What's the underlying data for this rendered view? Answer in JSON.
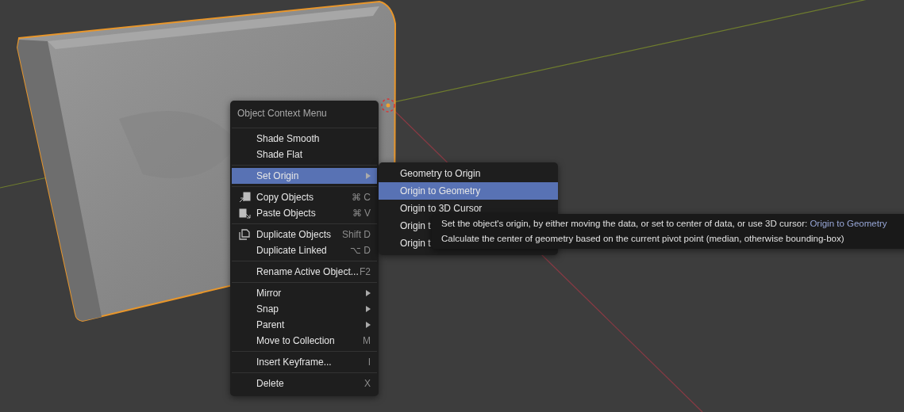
{
  "menu": {
    "title": "Object Context Menu",
    "sections": [
      [
        {
          "label": "Shade Smooth",
          "selected": false
        },
        {
          "label": "Shade Flat",
          "selected": false
        }
      ],
      [
        {
          "label": "Set Origin",
          "submenu": true,
          "selected": true
        }
      ],
      [
        {
          "label": "Copy Objects",
          "shortcut": "⌘ C",
          "kind": "copy",
          "selected": false
        },
        {
          "label": "Paste Objects",
          "shortcut": "⌘ V",
          "kind": "paste",
          "selected": false
        }
      ],
      [
        {
          "label": "Duplicate Objects",
          "shortcut": "Shift D",
          "kind": "duplicate",
          "selected": false
        },
        {
          "label": "Duplicate Linked",
          "shortcut": "⌥ D",
          "selected": false
        }
      ],
      [
        {
          "label": "Rename Active Object...",
          "shortcut": "F2",
          "selected": false
        }
      ],
      [
        {
          "label": "Mirror",
          "submenu": true,
          "selected": false
        },
        {
          "label": "Snap",
          "submenu": true,
          "selected": false
        },
        {
          "label": "Parent",
          "submenu": true,
          "selected": false
        },
        {
          "label": "Move to Collection",
          "shortcut": "M",
          "selected": false
        }
      ],
      [
        {
          "label": "Insert Keyframe...",
          "shortcut": "I",
          "selected": false
        }
      ],
      [
        {
          "label": "Delete",
          "shortcut": "X",
          "selected": false
        }
      ]
    ]
  },
  "submenu": {
    "items": [
      {
        "label": "Geometry to Origin",
        "selected": false
      },
      {
        "label": "Origin to Geometry",
        "selected": true
      },
      {
        "label": "Origin to 3D Cursor",
        "selected": false
      },
      {
        "label": "Origin t",
        "selected": false
      },
      {
        "label": "Origin t",
        "selected": false
      }
    ]
  },
  "tooltip": {
    "description": "Set the object's origin, by either moving the data, or set to center of data, or use 3D cursor:",
    "operator": "Origin to Geometry",
    "detail": "Calculate the center of geometry based on the current pivot point (median, otherwise bounding-box)"
  }
}
